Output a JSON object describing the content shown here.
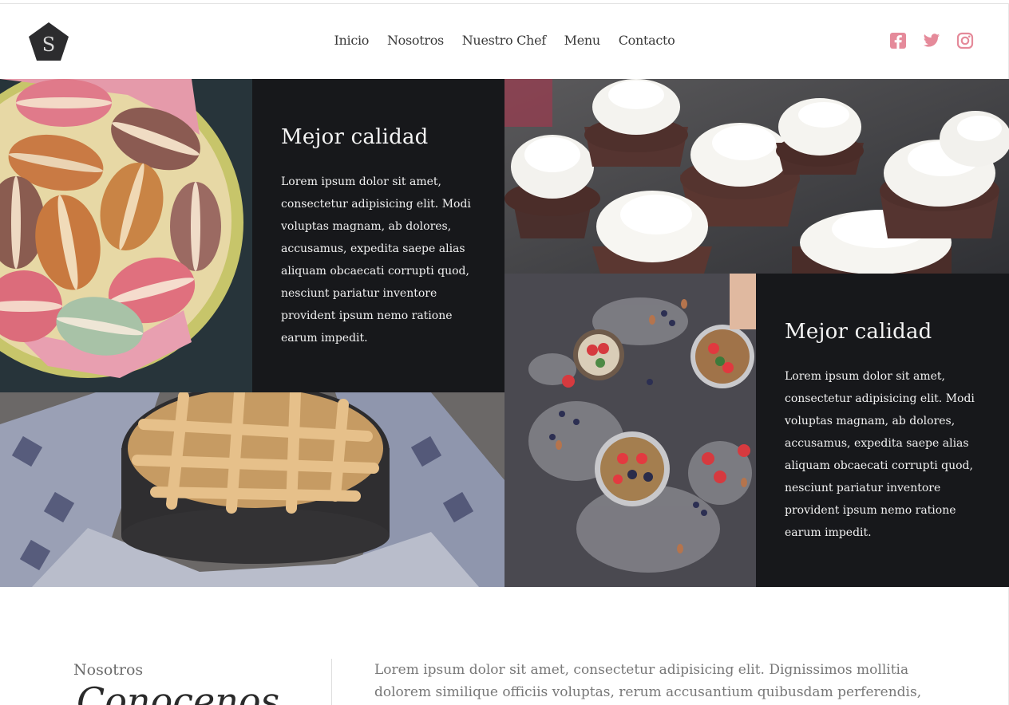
{
  "logo": {
    "letter": "S"
  },
  "nav": {
    "items": [
      "Inicio",
      "Nosotros",
      "Nuestro Chef",
      "Menu",
      "Contacto"
    ]
  },
  "social": {
    "icons": [
      "facebook-icon",
      "twitter-icon",
      "instagram-icon"
    ],
    "color": "#e58a9a"
  },
  "gallery": {
    "panel1": {
      "title": "Mejor calidad",
      "text": "Lorem ipsum dolor sit amet, consectetur adipisicing elit. Modi voluptas magnam, ab dolores, accusamus, expedita saepe alias aliquam obcaecati corrupti quod, nesciunt pariatur inventore provident ipsum nemo ratione earum impedit."
    },
    "panel2": {
      "title": "Mejor calidad",
      "text": "Lorem ipsum dolor sit amet, consectetur adipisicing elit. Modi voluptas magnam, ab dolores, accusamus, expedita saepe alias aliquam obcaecati corrupti quod, nesciunt pariatur inventore provident ipsum nemo ratione earum impedit."
    },
    "photos": [
      "macarons",
      "cupcakes",
      "berries-bowls",
      "apple-pie"
    ]
  },
  "about": {
    "label": "Nosotros",
    "heading": "Conocenos",
    "text": "Lorem ipsum dolor sit amet, consectetur adipisicing elit. Dignissimos mollitia dolorem similique officiis voluptas, rerum accusantium quibusdam perferendis, perspiciatis"
  },
  "colors": {
    "panel_bg": "#17181b",
    "accent": "#e58a9a"
  }
}
